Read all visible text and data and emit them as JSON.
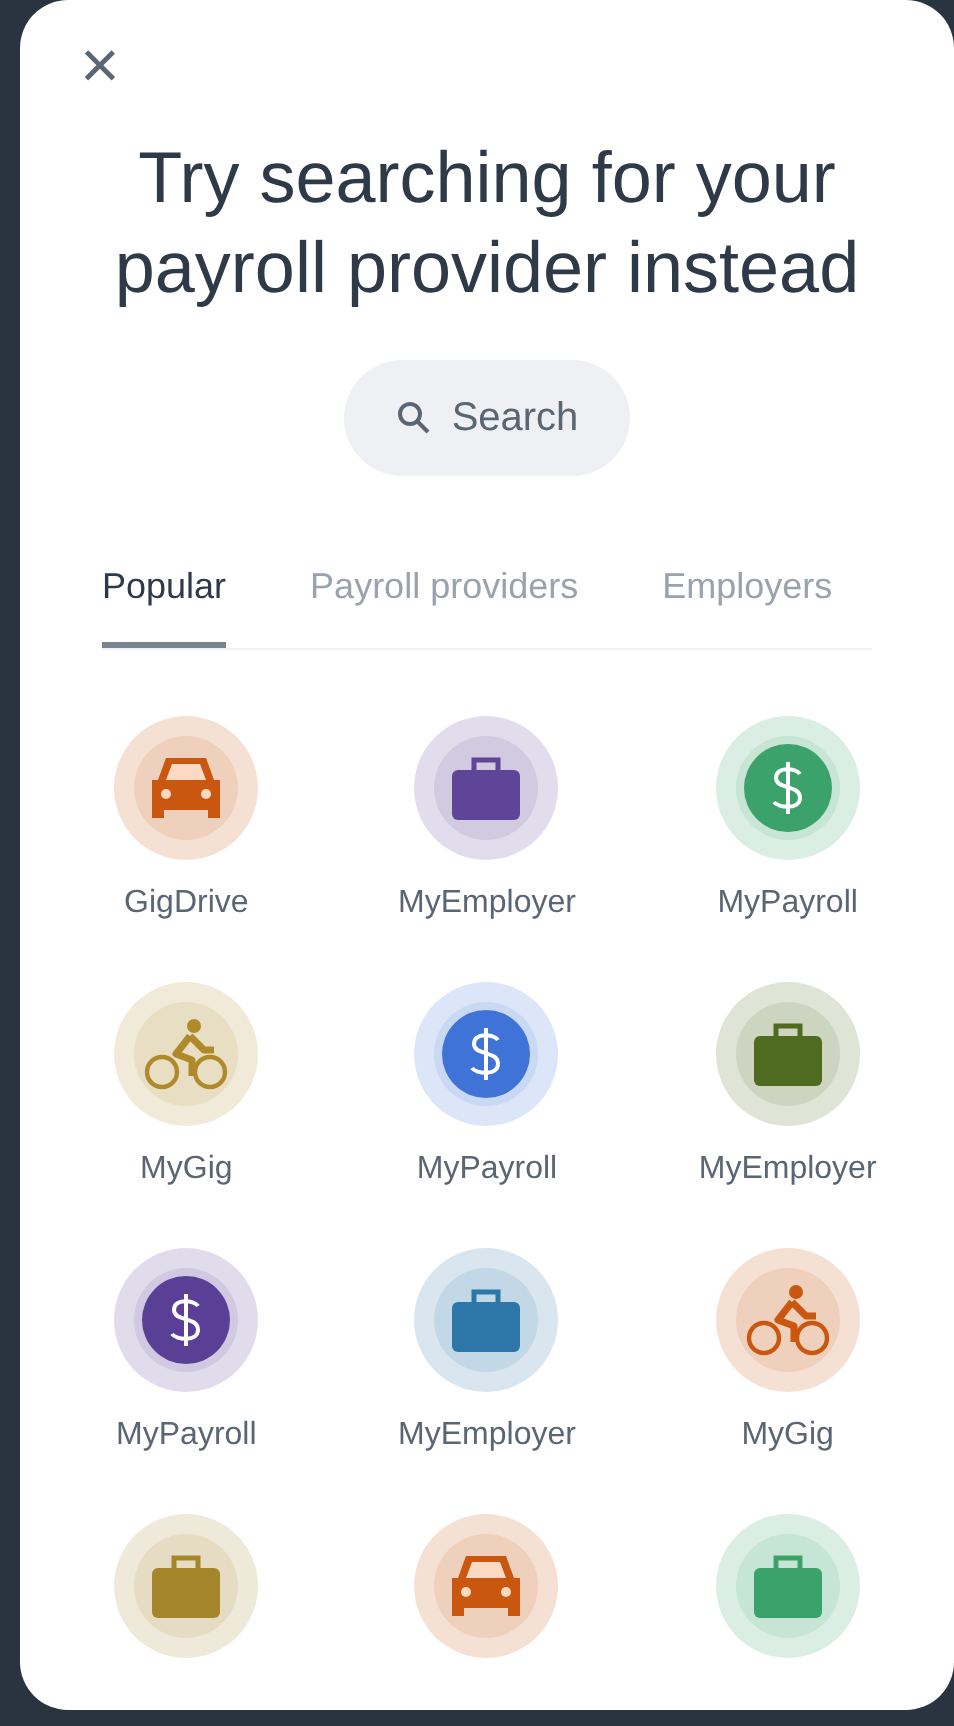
{
  "close": {
    "label": "×"
  },
  "title": "Try searching for your payroll provider instead",
  "search": {
    "label": "Search"
  },
  "tabs": [
    {
      "label": "Popular",
      "selected": true
    },
    {
      "label": "Payroll providers",
      "selected": false
    },
    {
      "label": "Employers",
      "selected": false
    }
  ],
  "providers": [
    {
      "kind": "car",
      "label": "GigDrive",
      "color": "#c9570f"
    },
    {
      "kind": "briefcase",
      "label": "MyEmployer",
      "color": "#5f4597"
    },
    {
      "kind": "dollar",
      "label": "MyPayroll",
      "color": "#3aa26a"
    },
    {
      "kind": "bike",
      "label": "MyGig",
      "color": "#b08a2a"
    },
    {
      "kind": "dollar",
      "label": "MyPayroll",
      "color": "#3f73d8"
    },
    {
      "kind": "briefcase",
      "label": "MyEmployer",
      "color": "#4f6b1f"
    },
    {
      "kind": "dollar",
      "label": "MyPayroll",
      "color": "#5a3f96"
    },
    {
      "kind": "briefcase",
      "label": "MyEmployer",
      "color": "#2c77a8"
    },
    {
      "kind": "bike",
      "label": "MyGig",
      "color": "#c9570f"
    },
    {
      "kind": "briefcase",
      "color": "#a6862a"
    },
    {
      "kind": "car",
      "color": "#c9570f"
    },
    {
      "kind": "briefcase",
      "color": "#3aa26a"
    }
  ]
}
